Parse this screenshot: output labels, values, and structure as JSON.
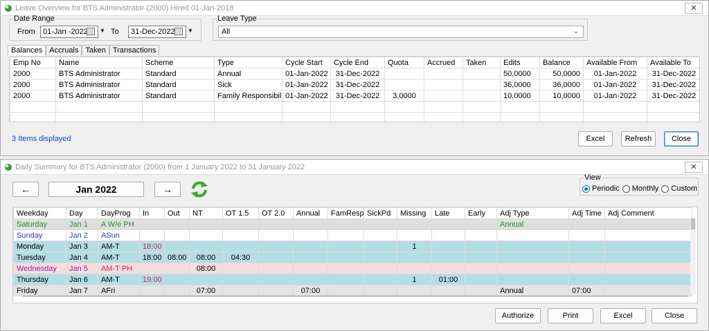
{
  "leave_window": {
    "title": "Leave Overview for BTS Administrator (2000)    Hired  01-Jan-2018",
    "close_glyph": "✕",
    "date_range": {
      "legend": "Date Range",
      "from_label": "From",
      "from_value": "01-Jan -2022",
      "to_label": "To",
      "to_value": "31-Dec-2022"
    },
    "leave_type": {
      "legend": "Leave Type",
      "value": "All"
    },
    "tabs": [
      "Balances",
      "Accruals",
      "Taken",
      "Transactions"
    ],
    "columns": [
      "Emp No",
      "Name",
      "Scheme",
      "Type",
      "Cycle Start",
      "Cycle End",
      "Quota",
      "Accrued",
      "Taken",
      "Edits",
      "Balance",
      "Available From",
      "Available To"
    ],
    "rows": [
      [
        "2000",
        "BTS Administrator",
        "Standard",
        "Annual",
        "01-Jan-2022",
        "31-Dec-2022",
        "",
        "",
        "",
        "50,0000",
        "50,0000",
        "01-Jan-2022",
        "31-Dec-2022"
      ],
      [
        "2000",
        "BTS Administrator",
        "Standard",
        "Sick",
        "01-Jan-2022",
        "31-Dec-2022",
        "",
        "",
        "",
        "36,0000",
        "36,0000",
        "01-Jan-2022",
        "31-Dec-2022"
      ],
      [
        "2000",
        "BTS Administrator",
        "Standard",
        "Family Responsibility",
        "01-Jan-2022",
        "31-Dec-2022",
        "3,0000",
        "",
        "",
        "10,0000",
        "10,0000",
        "01-Jan-2022",
        "31-Dec-2022"
      ]
    ],
    "status": "3 Items displayed",
    "buttons": {
      "excel": "Excel",
      "refresh": "Refresh",
      "close": "Close"
    }
  },
  "daily_window": {
    "title": "Daily Summary for BTS Administrator (2000)  from 1 January 2022  to  31 January 2022",
    "close_glyph": "✕",
    "prev_glyph": "🡐",
    "next_glyph": "🡒",
    "month": "Jan 2022",
    "view": {
      "legend": "View",
      "options": [
        "Periodic",
        "Monthly",
        "Custom"
      ],
      "selected": "Periodic"
    },
    "columns": [
      "Weekday",
      "Day",
      "DayProg",
      "In",
      "Out",
      "NT",
      "OT 1.5",
      "OT 2.0",
      "Annual",
      "FamResp",
      "SickPd",
      "Missing",
      "Late",
      "Early",
      "Adj Type",
      "Adj Time",
      "Adj Comment"
    ],
    "rows": [
      [
        "Saturday",
        "Jan 1",
        "A W/e PH",
        "",
        "",
        "",
        "",
        "",
        "",
        "",
        "",
        "",
        "",
        "",
        "Annual",
        "",
        ""
      ],
      [
        "Sunday",
        "Jan 2",
        "ASun",
        "",
        "",
        "",
        "",
        "",
        "",
        "",
        "",
        "",
        "",
        "",
        "",
        "",
        ""
      ],
      [
        "Monday",
        "Jan 3",
        "AM-T",
        "18:00",
        "",
        "",
        "",
        "",
        "",
        "",
        "",
        "1",
        "",
        "",
        "",
        "",
        ""
      ],
      [
        "Tuesday",
        "Jan 4",
        "AM-T",
        "18:00",
        "08:00",
        "08:00",
        "04:30",
        "",
        "",
        "",
        "",
        "",
        "",
        "",
        "",
        "",
        ""
      ],
      [
        "Wednesday",
        "Jan 5",
        "AM-T PH",
        "",
        "",
        "08:00",
        "",
        "",
        "",
        "",
        "",
        "",
        "",
        "",
        "",
        "",
        ""
      ],
      [
        "Thursday",
        "Jan 6",
        "AM-T",
        "19:00",
        "",
        "",
        "",
        "",
        "",
        "",
        "",
        "1",
        "01:00",
        "",
        "",
        "",
        ""
      ],
      [
        "Friday",
        "Jan 7",
        "AFri",
        "",
        "",
        "07:00",
        "",
        "",
        "07:00",
        "",
        "",
        "",
        "",
        "",
        "Annual",
        "07:00",
        ""
      ]
    ],
    "buttons": {
      "authorize": "Authorize",
      "print": "Print",
      "excel": "Excel",
      "close": "Close"
    }
  },
  "colors": {
    "weekday_row": "#b4dde6",
    "weekend_row": "#dedede",
    "holiday_row": "#f6dcdc",
    "link": "#1a3ed6",
    "accent": "#3a7bd5"
  }
}
